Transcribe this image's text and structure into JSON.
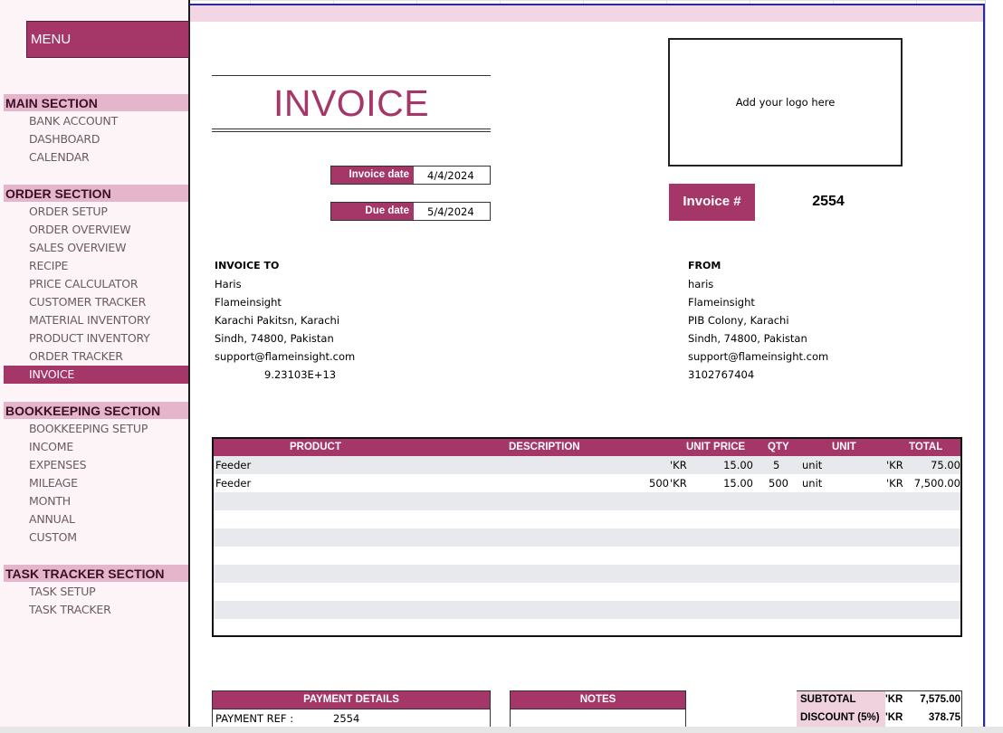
{
  "sidebar": {
    "menu_label": "MENU",
    "sections": [
      {
        "title": "MAIN SECTION",
        "items": [
          "BANK ACCOUNT",
          "DASHBOARD",
          "CALENDAR"
        ]
      },
      {
        "title": "ORDER SECTION",
        "items": [
          "ORDER SETUP",
          "ORDER OVERVIEW",
          "SALES OVERVIEW",
          "RECIPE",
          "PRICE CALCULATOR",
          "CUSTOMER TRACKER",
          "MATERIAL INVENTORY",
          "PRODUCT INVENTORY",
          "ORDER TRACKER",
          "INVOICE"
        ]
      },
      {
        "title": "BOOKKEEPING SECTION",
        "items": [
          "BOOKKEEPING SETUP",
          "INCOME",
          "EXPENSES",
          "MILEAGE",
          "MONTH",
          "ANNUAL",
          "CUSTOM"
        ]
      },
      {
        "title": "TASK TRACKER SECTION",
        "items": [
          "TASK SETUP",
          "TASK TRACKER"
        ]
      }
    ],
    "active_item": "INVOICE"
  },
  "invoice": {
    "title": "INVOICE",
    "invoice_date_label": "Invoice date",
    "invoice_date": "4/4/2024",
    "due_date_label": "Due date",
    "due_date": "5/4/2024",
    "logo_placeholder": "Add your logo here",
    "number_label": "Invoice #",
    "number": "2554"
  },
  "bill_to": {
    "heading": "INVOICE TO",
    "lines": [
      "Haris",
      "Flameinsight",
      "Karachi Pakitsn, Karachi",
      "Sindh, 74800, Pakistan",
      "support@flameinsight.com",
      "9.23103E+13"
    ]
  },
  "from": {
    "heading": "FROM",
    "lines": [
      "haris",
      "Flameinsight",
      "PIB Colony, Karachi",
      "Sindh, 74800, Pakistan",
      "support@flameinsight.com",
      "3102767404"
    ]
  },
  "items_table": {
    "headers": {
      "product": "PRODUCT",
      "description": "DESCRIPTION",
      "unit_price": "UNIT PRICE",
      "qty": "QTY",
      "unit": "UNIT",
      "total": "TOTAL"
    },
    "rows": [
      {
        "product": "Feeder",
        "description": "",
        "currency": "'KR",
        "unit_price": "15.00",
        "qty": "5",
        "unit": "unit",
        "total_currency": "'KR",
        "total": "75.00"
      },
      {
        "product": "Feeder",
        "description": "500",
        "currency": "'KR",
        "unit_price": "15.00",
        "qty": "500",
        "unit": "unit",
        "total_currency": "'KR",
        "total": "7,500.00"
      }
    ]
  },
  "payment": {
    "heading": "PAYMENT DETAILS",
    "ref_label": "PAYMENT REF :",
    "ref_value": "2554"
  },
  "notes": {
    "heading": "NOTES"
  },
  "totals": {
    "subtotal_label": "SUBTOTAL",
    "subtotal_currency": "'KR",
    "subtotal": "7,575.00",
    "discount_label": "DISCOUNT (5%)",
    "discount_currency": "'KR",
    "discount": "378.75"
  },
  "colors": {
    "accent": "#a43767",
    "section_head": "#e4b5cb",
    "sidebar_bg": "#fdf4f7",
    "row_shade": "#e8e9ec"
  }
}
